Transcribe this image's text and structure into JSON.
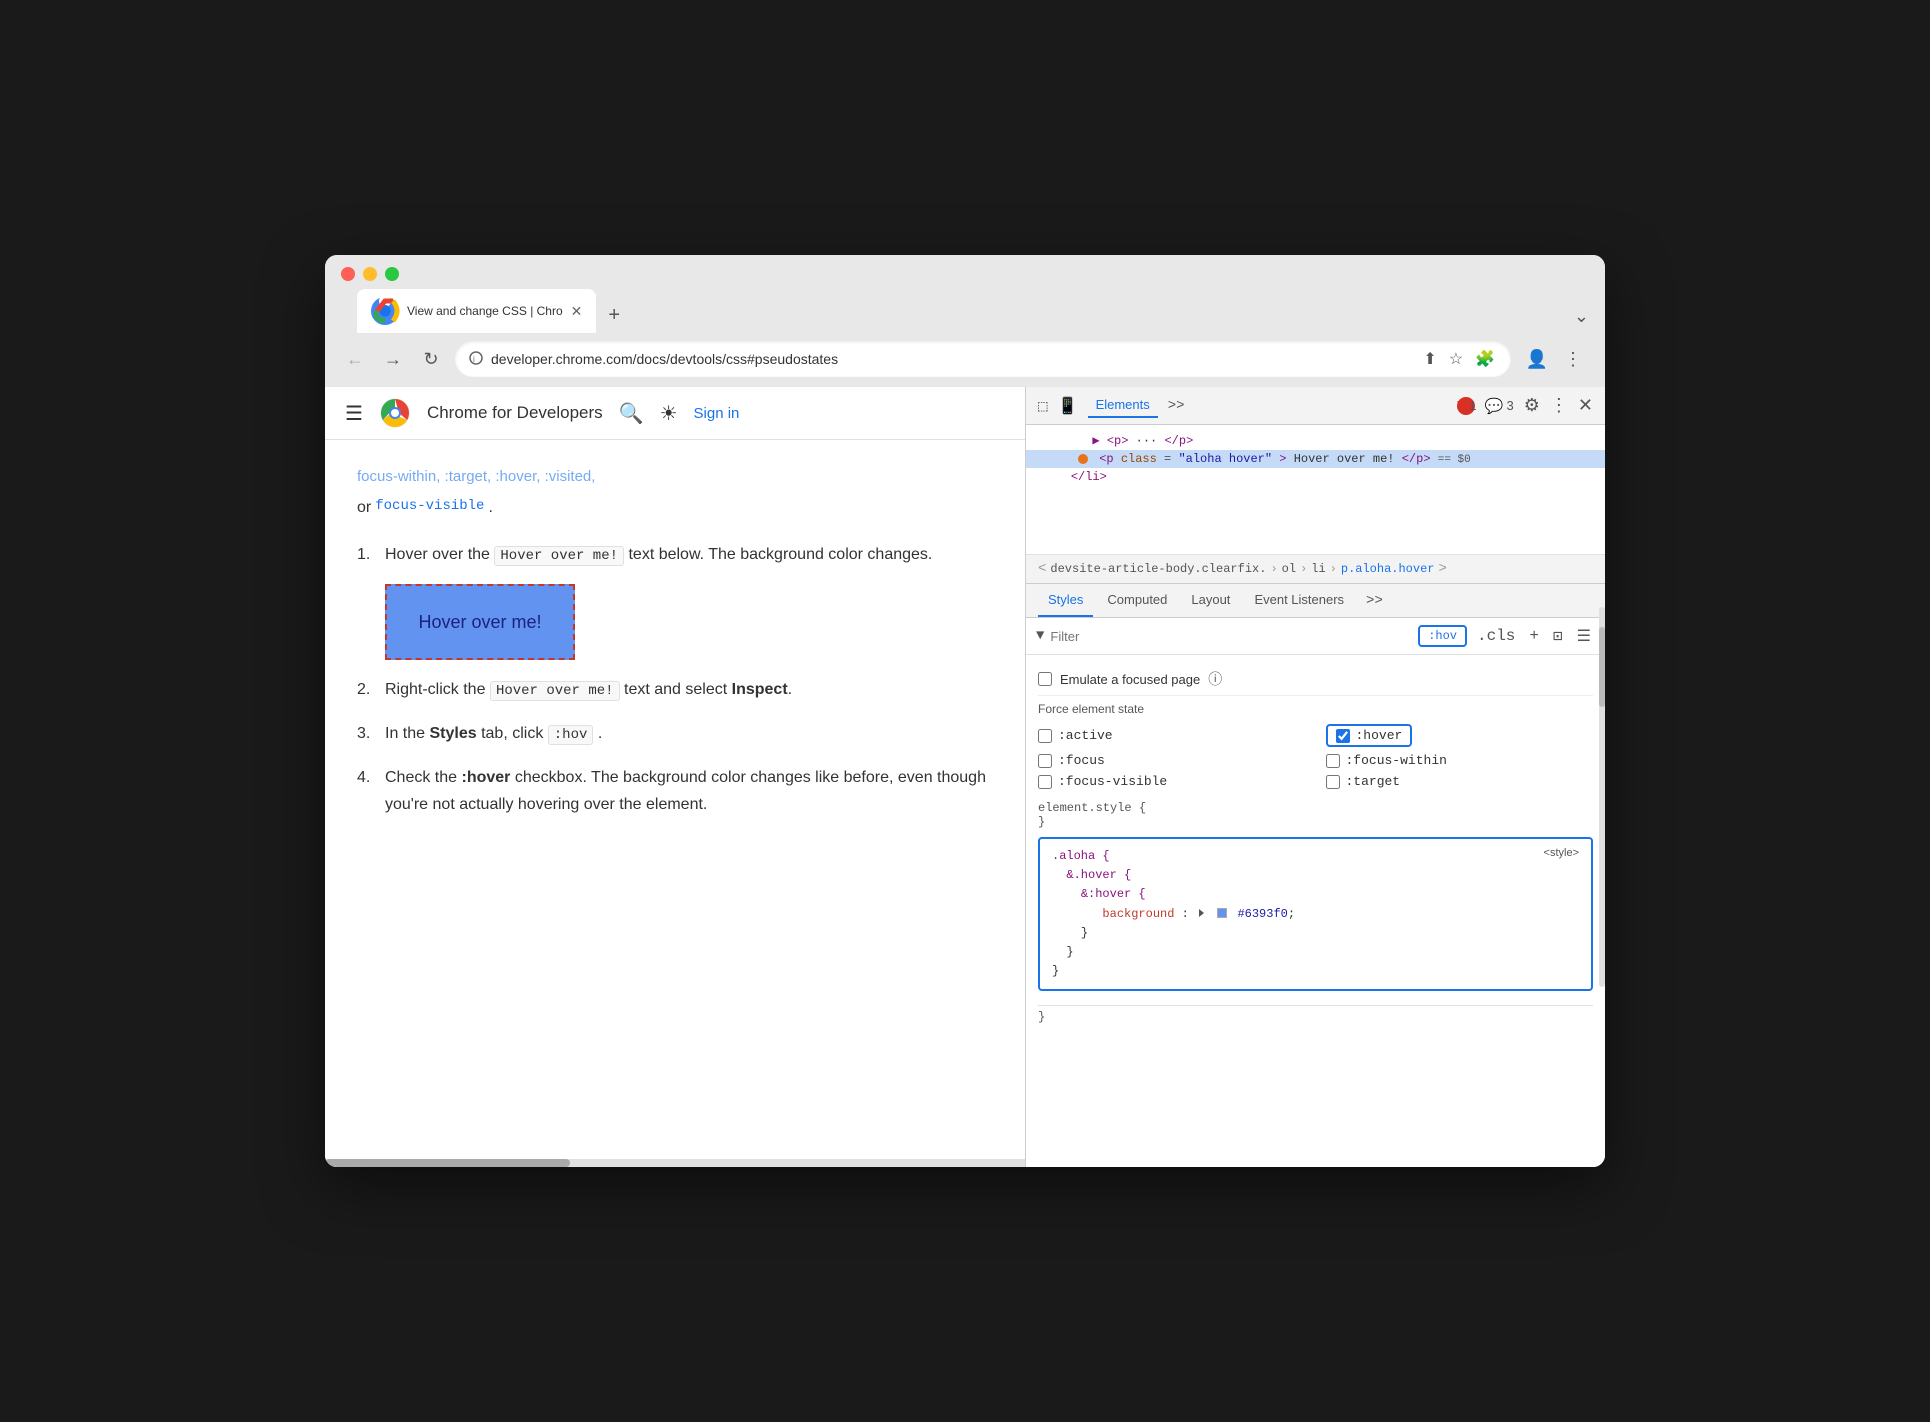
{
  "browser": {
    "tab_title": "View and change CSS | Chro",
    "tab_new_label": "+",
    "tab_menu_label": "⌄",
    "traffic_lights": [
      "red",
      "yellow",
      "green"
    ],
    "url": "developer.chrome.com/docs/devtools/css#pseudostates",
    "nav_back": "←",
    "nav_forward": "→",
    "nav_reload": "↻"
  },
  "page": {
    "site_name": "Chrome for Developers",
    "sign_in": "Sign in",
    "faded_links": "focus-within, :target, :hover, :visited,",
    "focus_visible": "focus-visible",
    "period": ".",
    "list_items": [
      {
        "num": "1.",
        "text_before": "Hover over the",
        "code": "Hover over me!",
        "text_after": "text below. The background color changes."
      },
      {
        "num": "2.",
        "text_before": "Right-click the",
        "code": "Hover over me!",
        "text_after": "text and select",
        "bold": "Inspect",
        "period": "."
      },
      {
        "num": "3.",
        "text_before": "In the",
        "bold_before": "Styles",
        "text_middle": "tab, click",
        "code_after": ":hov",
        "period": "."
      },
      {
        "num": "4.",
        "text_before": "Check the",
        "bold": ":hover",
        "text_after": "checkbox. The background color changes like before, even though you're not actually hovering over the element."
      }
    ],
    "hover_box_label": "Hover over me!"
  },
  "devtools": {
    "toolbar": {
      "tabs": [
        "Elements",
        ">>"
      ],
      "active_tab": "Elements",
      "error_count": "1",
      "warning_count": "3",
      "settings_icon": "⚙",
      "more_icon": "⋮",
      "close_icon": "✕"
    },
    "dom": {
      "lines": [
        "▶ <p> ··· </p>",
        "<p class=\"aloha hover\">Hover over me!</p>  == $0",
        "</li>"
      ]
    },
    "breadcrumb": {
      "items": [
        "devsite-article-body.clearfix.",
        "ol",
        "li",
        "p.aloha.hover"
      ]
    },
    "styles_tabs": [
      "Styles",
      "Computed",
      "Layout",
      "Event Listeners",
      ">>"
    ],
    "active_styles_tab": "Styles",
    "filter": {
      "placeholder": "Filter",
      "hov_label": ":hov",
      "cls_label": ".cls",
      "add_rule": "+",
      "layout_icon": "⊡",
      "computed_icon": "☰"
    },
    "focused_page": {
      "label": "Emulate a focused page",
      "help": "?"
    },
    "force_state": {
      "label": "Force element state",
      "states": [
        {
          "label": ":active",
          "checked": false,
          "col": 1
        },
        {
          "label": ":hover",
          "checked": true,
          "col": 2
        },
        {
          "label": ":focus",
          "checked": false,
          "col": 1
        },
        {
          "label": ":focus-within",
          "checked": false,
          "col": 2
        },
        {
          "label": ":focus-visible",
          "checked": false,
          "col": 1
        },
        {
          "label": ":target",
          "checked": false,
          "col": 2
        }
      ]
    },
    "element_style": {
      "selector": "element.style {",
      "close": "}"
    },
    "css_block": {
      "selectors": [
        ".aloha {",
        "&.hover {",
        "  &:hover {"
      ],
      "property": "background",
      "colon": ":",
      "value": "#6393f0",
      "close_lines": [
        "  }",
        "}",
        "}"
      ],
      "source": "<style>"
    }
  }
}
